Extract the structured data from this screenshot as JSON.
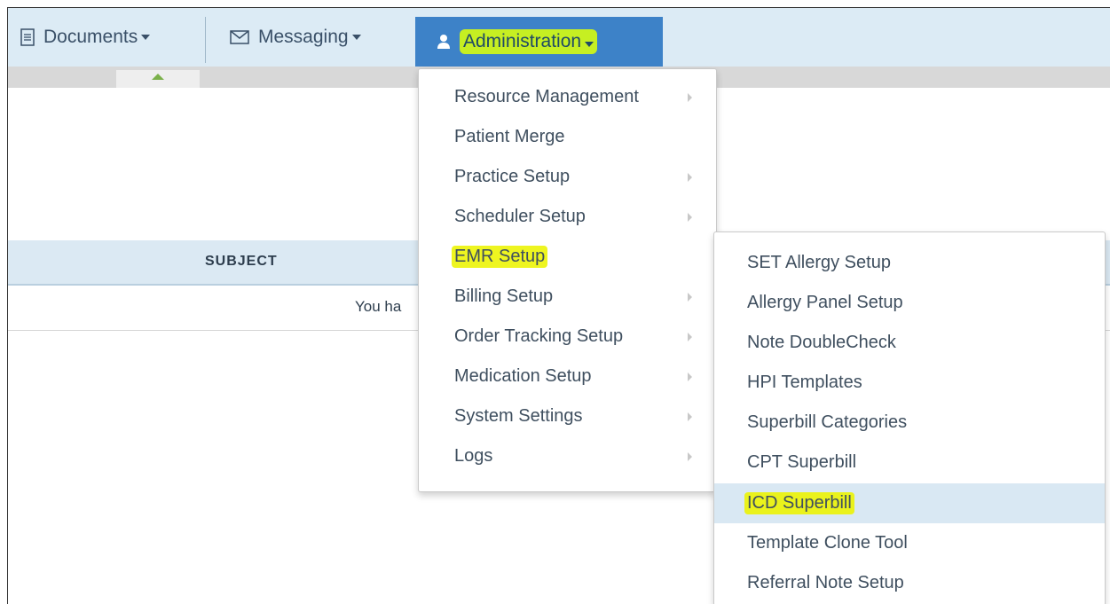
{
  "navbar": {
    "documents_label": "Documents",
    "messaging_label": "Messaging",
    "administration_label": "Administration"
  },
  "table": {
    "header_subject": "SUBJECT",
    "empty_message": "You ha"
  },
  "admin_menu": {
    "items": [
      {
        "label": "Resource Management"
      },
      {
        "label": "Patient Merge"
      },
      {
        "label": "Practice Setup"
      },
      {
        "label": "Scheduler Setup"
      },
      {
        "label": "EMR Setup"
      },
      {
        "label": "Billing Setup"
      },
      {
        "label": "Order Tracking Setup"
      },
      {
        "label": "Medication Setup"
      },
      {
        "label": "System Settings"
      },
      {
        "label": "Logs"
      }
    ]
  },
  "emr_submenu": {
    "items": [
      {
        "label": "SET Allergy Setup"
      },
      {
        "label": "Allergy Panel Setup"
      },
      {
        "label": "Note DoubleCheck"
      },
      {
        "label": "HPI Templates"
      },
      {
        "label": "Superbill Categories"
      },
      {
        "label": "CPT Superbill"
      },
      {
        "label": "ICD Superbill"
      },
      {
        "label": "Template Clone Tool"
      },
      {
        "label": "Referral Note Setup"
      }
    ]
  },
  "colors": {
    "navbar_bg": "#dcebf5",
    "active_tab": "#3d82c8",
    "highlighter": "#eef520"
  }
}
